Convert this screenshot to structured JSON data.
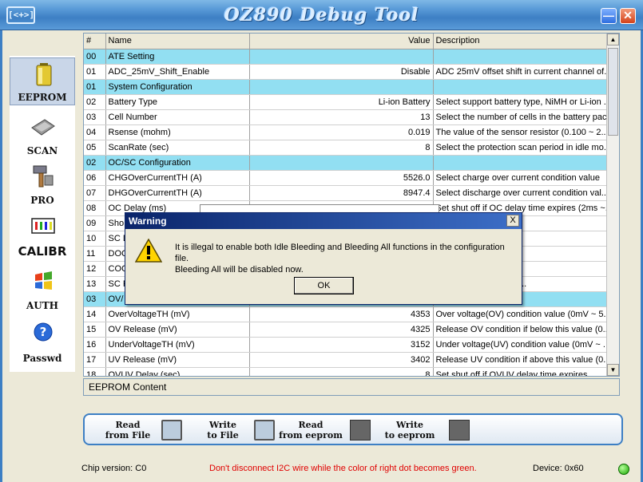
{
  "window": {
    "title": "OZ890 Debug Tool",
    "icon_text": "[<+>]",
    "min_label": "—",
    "close_label": "✕"
  },
  "nav": [
    {
      "label": "EEPROM",
      "icon": "battery-icon",
      "active": true
    },
    {
      "label": "SCAN",
      "icon": "chip-icon",
      "active": false
    },
    {
      "label": "PRO",
      "icon": "hammer-icon",
      "active": false
    },
    {
      "label": "CALIBR",
      "icon": "calibration-icon",
      "active": false
    },
    {
      "label": "AUTH",
      "icon": "windows-logo-icon",
      "active": false
    },
    {
      "label": "Passwd",
      "icon": "help-icon",
      "active": false
    }
  ],
  "table": {
    "headers": [
      "#",
      "Name",
      "Value",
      "Description"
    ],
    "rows": [
      {
        "num": "00",
        "name": "ATE Setting",
        "value": "",
        "desc": "",
        "section": true
      },
      {
        "num": "01",
        "name": "ADC_25mV_Shift_Enable",
        "value": "Disable",
        "desc": "ADC 25mV offset shift in current channel of...",
        "section": false
      },
      {
        "num": "01",
        "name": "System Configuration",
        "value": "",
        "desc": "",
        "section": true
      },
      {
        "num": "02",
        "name": "Battery Type",
        "value": "Li-ion Battery",
        "desc": "Select support battery type, NiMH or Li-ion ...",
        "section": false
      },
      {
        "num": "03",
        "name": "Cell Number",
        "value": "13",
        "desc": "Select the number of cells in the battery pack",
        "section": false
      },
      {
        "num": "04",
        "name": "Rsense (mohm)",
        "value": "0.019",
        "desc": "The value of the sensor resistor (0.100 ~ 2...",
        "section": false
      },
      {
        "num": "05",
        "name": "ScanRate (sec)",
        "value": "8",
        "desc": "Select the protection scan period in idle mo...",
        "section": false
      },
      {
        "num": "02",
        "name": "OC/SC Configuration",
        "value": "",
        "desc": "",
        "section": true
      },
      {
        "num": "06",
        "name": "CHGOverCurrentTH (A)",
        "value": "5526.0",
        "desc": "Select charge over current condition value",
        "section": false
      },
      {
        "num": "07",
        "name": "DHGOverCurrentTH (A)",
        "value": "8947.4",
        "desc": "Select discharge over current condition val...",
        "section": false
      },
      {
        "num": "08",
        "name": "OC Delay (ms)",
        "value": "",
        "desc": "Set shut off if OC delay time expires (2ms ~...",
        "section": false
      },
      {
        "num": "09",
        "name": "Sho",
        "value": "",
        "desc": "ndition value",
        "section": false
      },
      {
        "num": "10",
        "name": "SC D",
        "value": "",
        "desc": "time expires (8us ~...",
        "section": false
      },
      {
        "num": "11",
        "name": "DOC",
        "value": "",
        "desc": "e",
        "section": false
      },
      {
        "num": "12",
        "name": "COC",
        "value": "",
        "desc": "e",
        "section": false
      },
      {
        "num": "13",
        "name": "SC R",
        "value": "",
        "desc": "dition by timer or scrl ...",
        "section": false
      },
      {
        "num": "03",
        "name": "OV/",
        "value": "",
        "desc": "",
        "section": true
      },
      {
        "num": "14",
        "name": "OverVoltageTH (mV)",
        "value": "4353",
        "desc": "Over voltage(OV) condition value (0mV ~ 5...",
        "section": false
      },
      {
        "num": "15",
        "name": "OV Release (mV)",
        "value": "4325",
        "desc": "Release OV condition if below this value (0...",
        "section": false
      },
      {
        "num": "16",
        "name": "UnderVoltageTH (mV)",
        "value": "3152",
        "desc": "Under voltage(UV) condition value (0mV ~ ...",
        "section": false
      },
      {
        "num": "17",
        "name": "UV Release (mV)",
        "value": "3402",
        "desc": "Release UV condition if above this value (0...",
        "section": false
      },
      {
        "num": "18",
        "name": "OVUV Delay (sec)",
        "value": "8",
        "desc": "Set shut off if OVUV delay time expires",
        "section": false
      }
    ]
  },
  "content_label": "EEPROM Content",
  "toolbar": {
    "read_file": [
      "Read",
      "from File"
    ],
    "write_file": [
      "Write",
      "to File"
    ],
    "read_eeprom": [
      "Read",
      "from eeprom"
    ],
    "write_eeprom": [
      "Write",
      "to eeprom"
    ]
  },
  "status": {
    "chip_version": "Chip version: C0",
    "warning": "Don't disconnect I2C wire while the color of right dot becomes green.",
    "device": "Device: 0x60",
    "warning_color": "#e00000",
    "dot_color": "#18a600"
  },
  "dialog": {
    "title": "Warning",
    "close_label": "X",
    "message": "It is illegal to enable both Idle Bleeding and Bleeding All functions in the configuration file.\nBleeding All will be disabled now.",
    "ok_label": "OK"
  }
}
